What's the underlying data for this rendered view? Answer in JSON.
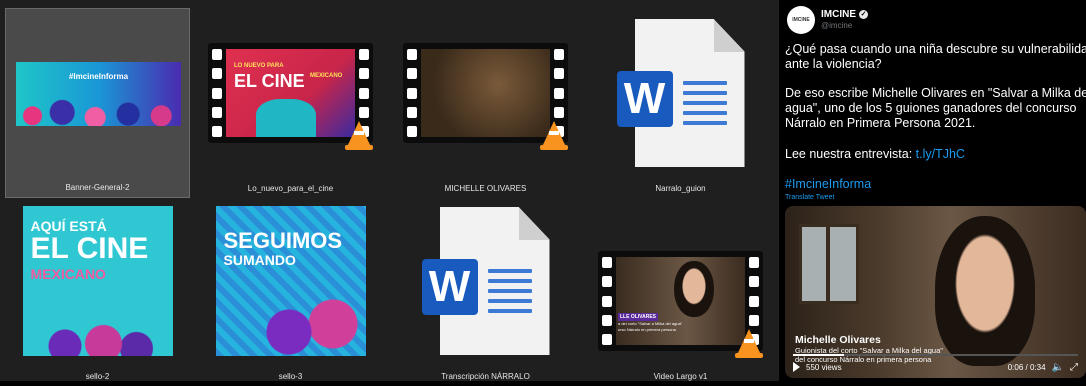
{
  "files": [
    {
      "name": "Banner-General-2",
      "kind": "image",
      "selected": true,
      "overlay": "#ImcineInforma"
    },
    {
      "name": "Lo_nuevo_para_el_cine",
      "kind": "video",
      "overlay_small": "LO NUEVO PARA",
      "overlay_big": "EL CINE",
      "overlay_right": "MEXICANO"
    },
    {
      "name": "MICHELLE OLIVARES",
      "kind": "video"
    },
    {
      "name": "Narralo_guion",
      "kind": "word",
      "letter": "W"
    },
    {
      "name": "sello-2",
      "kind": "image",
      "line1": "AQUÍ ESTÁ",
      "line2": "EL CINE",
      "line3": "MEXICANO"
    },
    {
      "name": "sello-3",
      "kind": "image",
      "line1": "SEGUIMOS",
      "line2": "SUMANDO"
    },
    {
      "name": "Transcripción NÁRRALO",
      "kind": "word",
      "letter": "W"
    },
    {
      "name": "Video Largo v1",
      "kind": "video",
      "lower_name": "LLE OLIVARES",
      "lower_sub1": "a del corto \"Salvar a Milka del agua\"",
      "lower_sub2": "urso Nárralo en primera persona"
    }
  ],
  "tweet": {
    "avatar_text": "IMCINE",
    "display_name": "IMCINE",
    "verified_icon": "verified-check-icon",
    "handle": "@imcine",
    "line1": "¿Qué pasa cuando una niña descubre su vulnerabilidad",
    "line2": "ante la violencia?",
    "line3": "De eso escribe Michelle Olivares en \"Salvar a Milka del",
    "line4": "agua\", uno de los 5 guiones ganadores del concurso",
    "line5": "Nárralo en Primera Persona 2021.",
    "read_prefix": "Lee nuestra entrevista: ",
    "read_link": "t.ly/TJhC",
    "hashtag": "#ImcineInforma",
    "translate": "Translate Tweet",
    "video": {
      "lower_name": "Michelle Olivares",
      "lower_sub1": "Guionista del corto \"Salvar a Milka del agua\"",
      "lower_sub2": "del concurso Nárralo en primera persona",
      "views": "550 views",
      "time": "0:06 / 0:34",
      "progress": 0.18
    }
  },
  "colors": {
    "explorer_bg": "#1f1f1f",
    "selected": "#4a4a4a",
    "word_blue": "#185abd",
    "vlc_orange": "#f7931e",
    "twitter_link": "#1d9bf0"
  }
}
